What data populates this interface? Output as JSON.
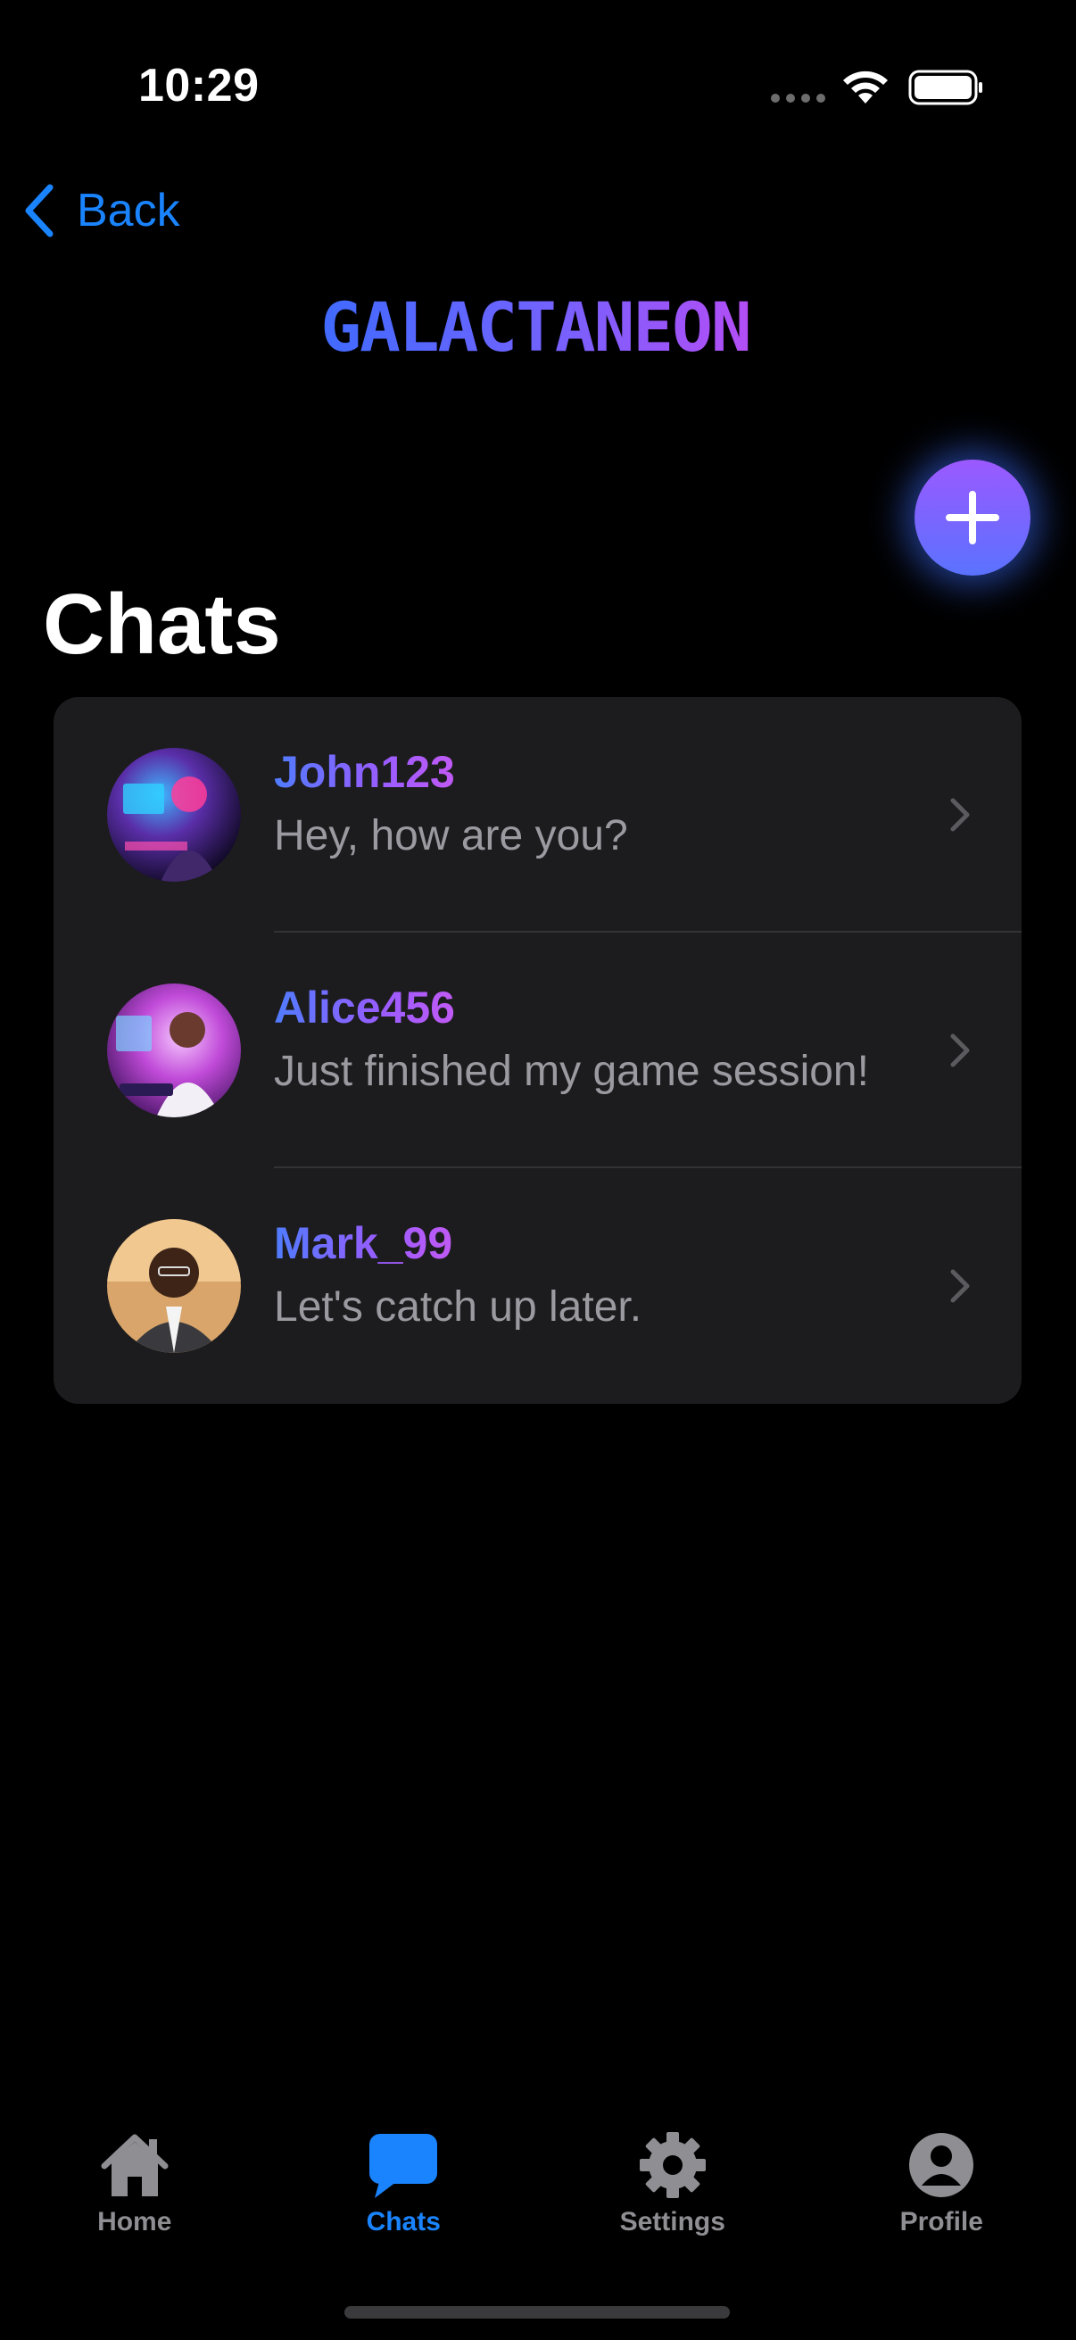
{
  "status_bar": {
    "time": "10:29"
  },
  "nav": {
    "back_label": "Back"
  },
  "app": {
    "logo_text": "GALACTANEON"
  },
  "page": {
    "title": "Chats"
  },
  "chats": [
    {
      "name": "John123",
      "preview": "Hey, how are you?",
      "avatar": "gamer-avatar"
    },
    {
      "name": "Alice456",
      "preview": "Just finished my game session!",
      "avatar": "gamer-girl-avatar"
    },
    {
      "name": "Mark_99",
      "preview": "Let's catch up later.",
      "avatar": "man-portrait-avatar"
    }
  ],
  "tabs": [
    {
      "label": "Home",
      "icon": "house-icon"
    },
    {
      "label": "Chats",
      "icon": "chat-bubble-icon",
      "active": true
    },
    {
      "label": "Settings",
      "icon": "gear-icon"
    },
    {
      "label": "Profile",
      "icon": "person-circle-icon"
    }
  ],
  "colors": {
    "accent": "#1a84ff",
    "gradient_start": "#3d6bff",
    "gradient_end": "#c15af5",
    "card_bg": "#1c1c1e",
    "muted_text": "#9a9aa0"
  }
}
